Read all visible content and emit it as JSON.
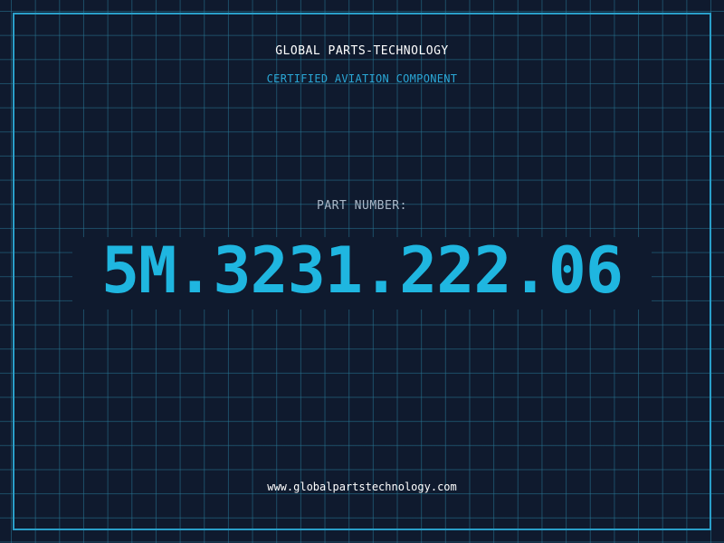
{
  "header": {
    "company": "GLOBAL PARTS-TECHNOLOGY",
    "subtitle": "CERTIFIED AVIATION COMPONENT"
  },
  "part": {
    "label": "PART NUMBER:",
    "number": "5M.3231.222.06"
  },
  "footer": {
    "website": "www.globalpartstechnology.com"
  },
  "colors": {
    "background": "#0f1a2e",
    "grid": "#28789a",
    "frame": "#2a9fc9",
    "accent": "#1fb6e0",
    "text": "#ffffff",
    "label": "#aab8c8"
  }
}
